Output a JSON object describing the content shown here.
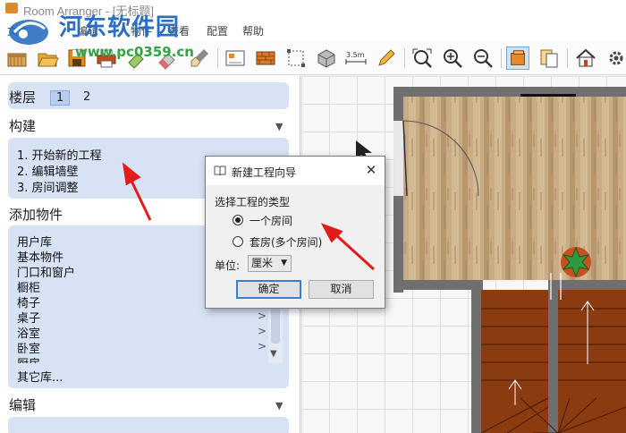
{
  "window": {
    "title": "Room Arranger - [无标题]"
  },
  "watermark": {
    "site_name": "河东软件园",
    "url": "www.pc0359.cn"
  },
  "menu": [
    "文件",
    "编辑",
    "物件",
    "查看",
    "配置",
    "帮助"
  ],
  "toolbar": {
    "icons": [
      "new-project-icon",
      "open-folder-icon",
      "save-icon",
      "print-icon",
      "object-color-icon",
      "eraser-icon",
      "brush-icon",
      "picture-icon",
      "wall-icon",
      "select-area-icon",
      "3d-box-icon",
      "rotate-icon",
      "measure-icon",
      "pencil-icon",
      "zoom-fit-icon",
      "zoom-in-icon",
      "zoom-out-icon",
      "3d-view-icon",
      "copy-icon",
      "house-icon",
      "settings-icon"
    ],
    "measure_label": "3.5m",
    "active": "3d-view-icon"
  },
  "left_panel": {
    "floors": {
      "label": "楼层",
      "items": [
        "1",
        "2"
      ],
      "selected": "1"
    },
    "build": {
      "label": "构建",
      "items": [
        "1. 开始新的工程",
        "2. 编辑墙壁",
        "3. 房间调整"
      ]
    },
    "add_objects": {
      "label": "添加物件",
      "items": [
        "用户库",
        "基本物件",
        "门口和窗户",
        "橱柜",
        "椅子",
        "桌子",
        "浴室",
        "卧室",
        "厨房"
      ],
      "submenu_marker": ">",
      "more": "其它库..."
    },
    "edit": {
      "label": "编辑"
    },
    "collapse_marker": "▼"
  },
  "dialog": {
    "title": "新建工程向导",
    "close": "✕",
    "prompt": "选择工程的类型",
    "options": [
      "一个房间",
      "套房(多个房间)"
    ],
    "selected_option": 0,
    "unit_label": "单位:",
    "unit_value": "厘米",
    "ok": "确定",
    "cancel": "取消"
  },
  "colors": {
    "panel_box": "#d7e2f5",
    "wood_floor": "#c9ab86",
    "stairs": "#8a3b10",
    "wall": "#6f6f6f",
    "annotation_arrow": "#e21b1b",
    "plant": "#2e9a3d"
  }
}
